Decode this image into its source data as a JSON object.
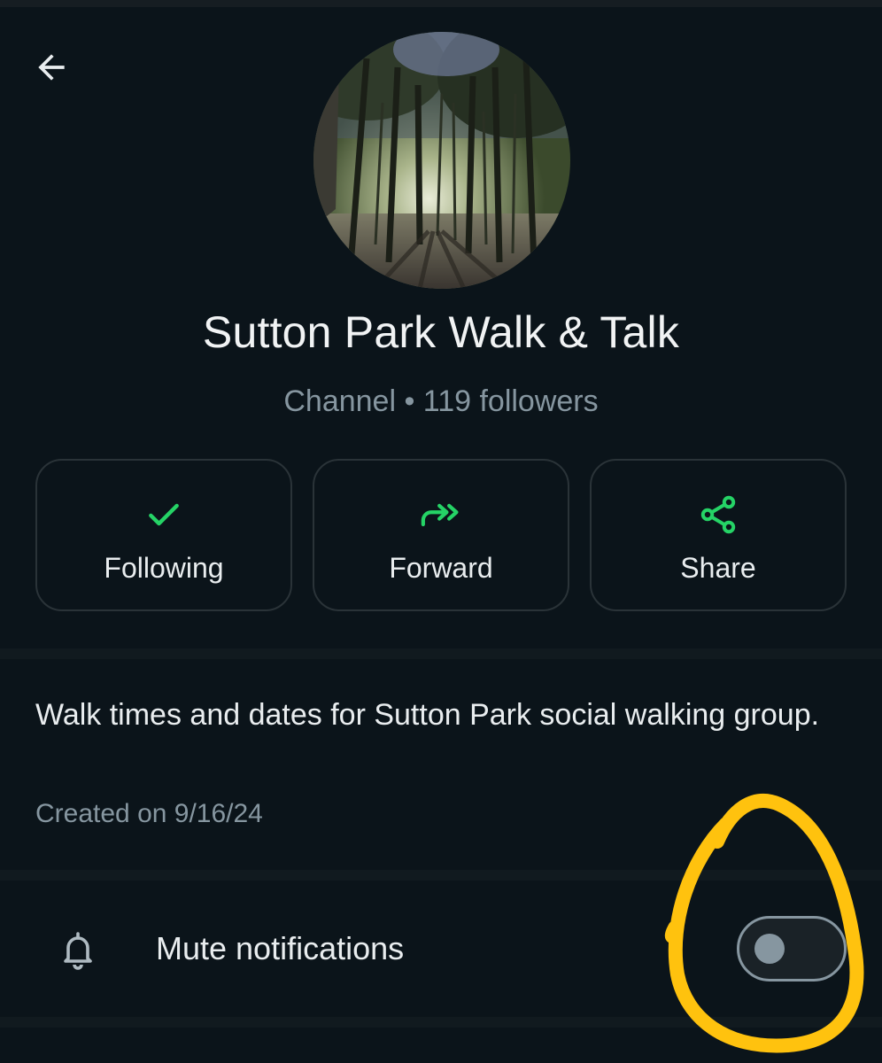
{
  "header": {
    "back_icon": "arrow-left-icon"
  },
  "channel": {
    "name": "Sutton Park Walk & Talk",
    "subtitle": "Channel • 119 followers",
    "avatar_alt": "forest-photo"
  },
  "actions": [
    {
      "label": "Following",
      "icon": "check-icon",
      "color": "#25d366"
    },
    {
      "label": "Forward",
      "icon": "forward-icon",
      "color": "#25d366"
    },
    {
      "label": "Share",
      "icon": "share-icon",
      "color": "#25d366"
    }
  ],
  "about": {
    "description": "Walk times and dates for Sutton Park social walking group.",
    "created": "Created on 9/16/24"
  },
  "settings": {
    "mute_label": "Mute notifications",
    "mute_icon": "bell-icon",
    "mute_enabled": false
  },
  "annotation": {
    "color": "#ffc20e",
    "shape": "hand-drawn-circle"
  },
  "colors": {
    "background": "#0b141a",
    "accent": "#25d366",
    "muted_text": "#8696a0"
  }
}
